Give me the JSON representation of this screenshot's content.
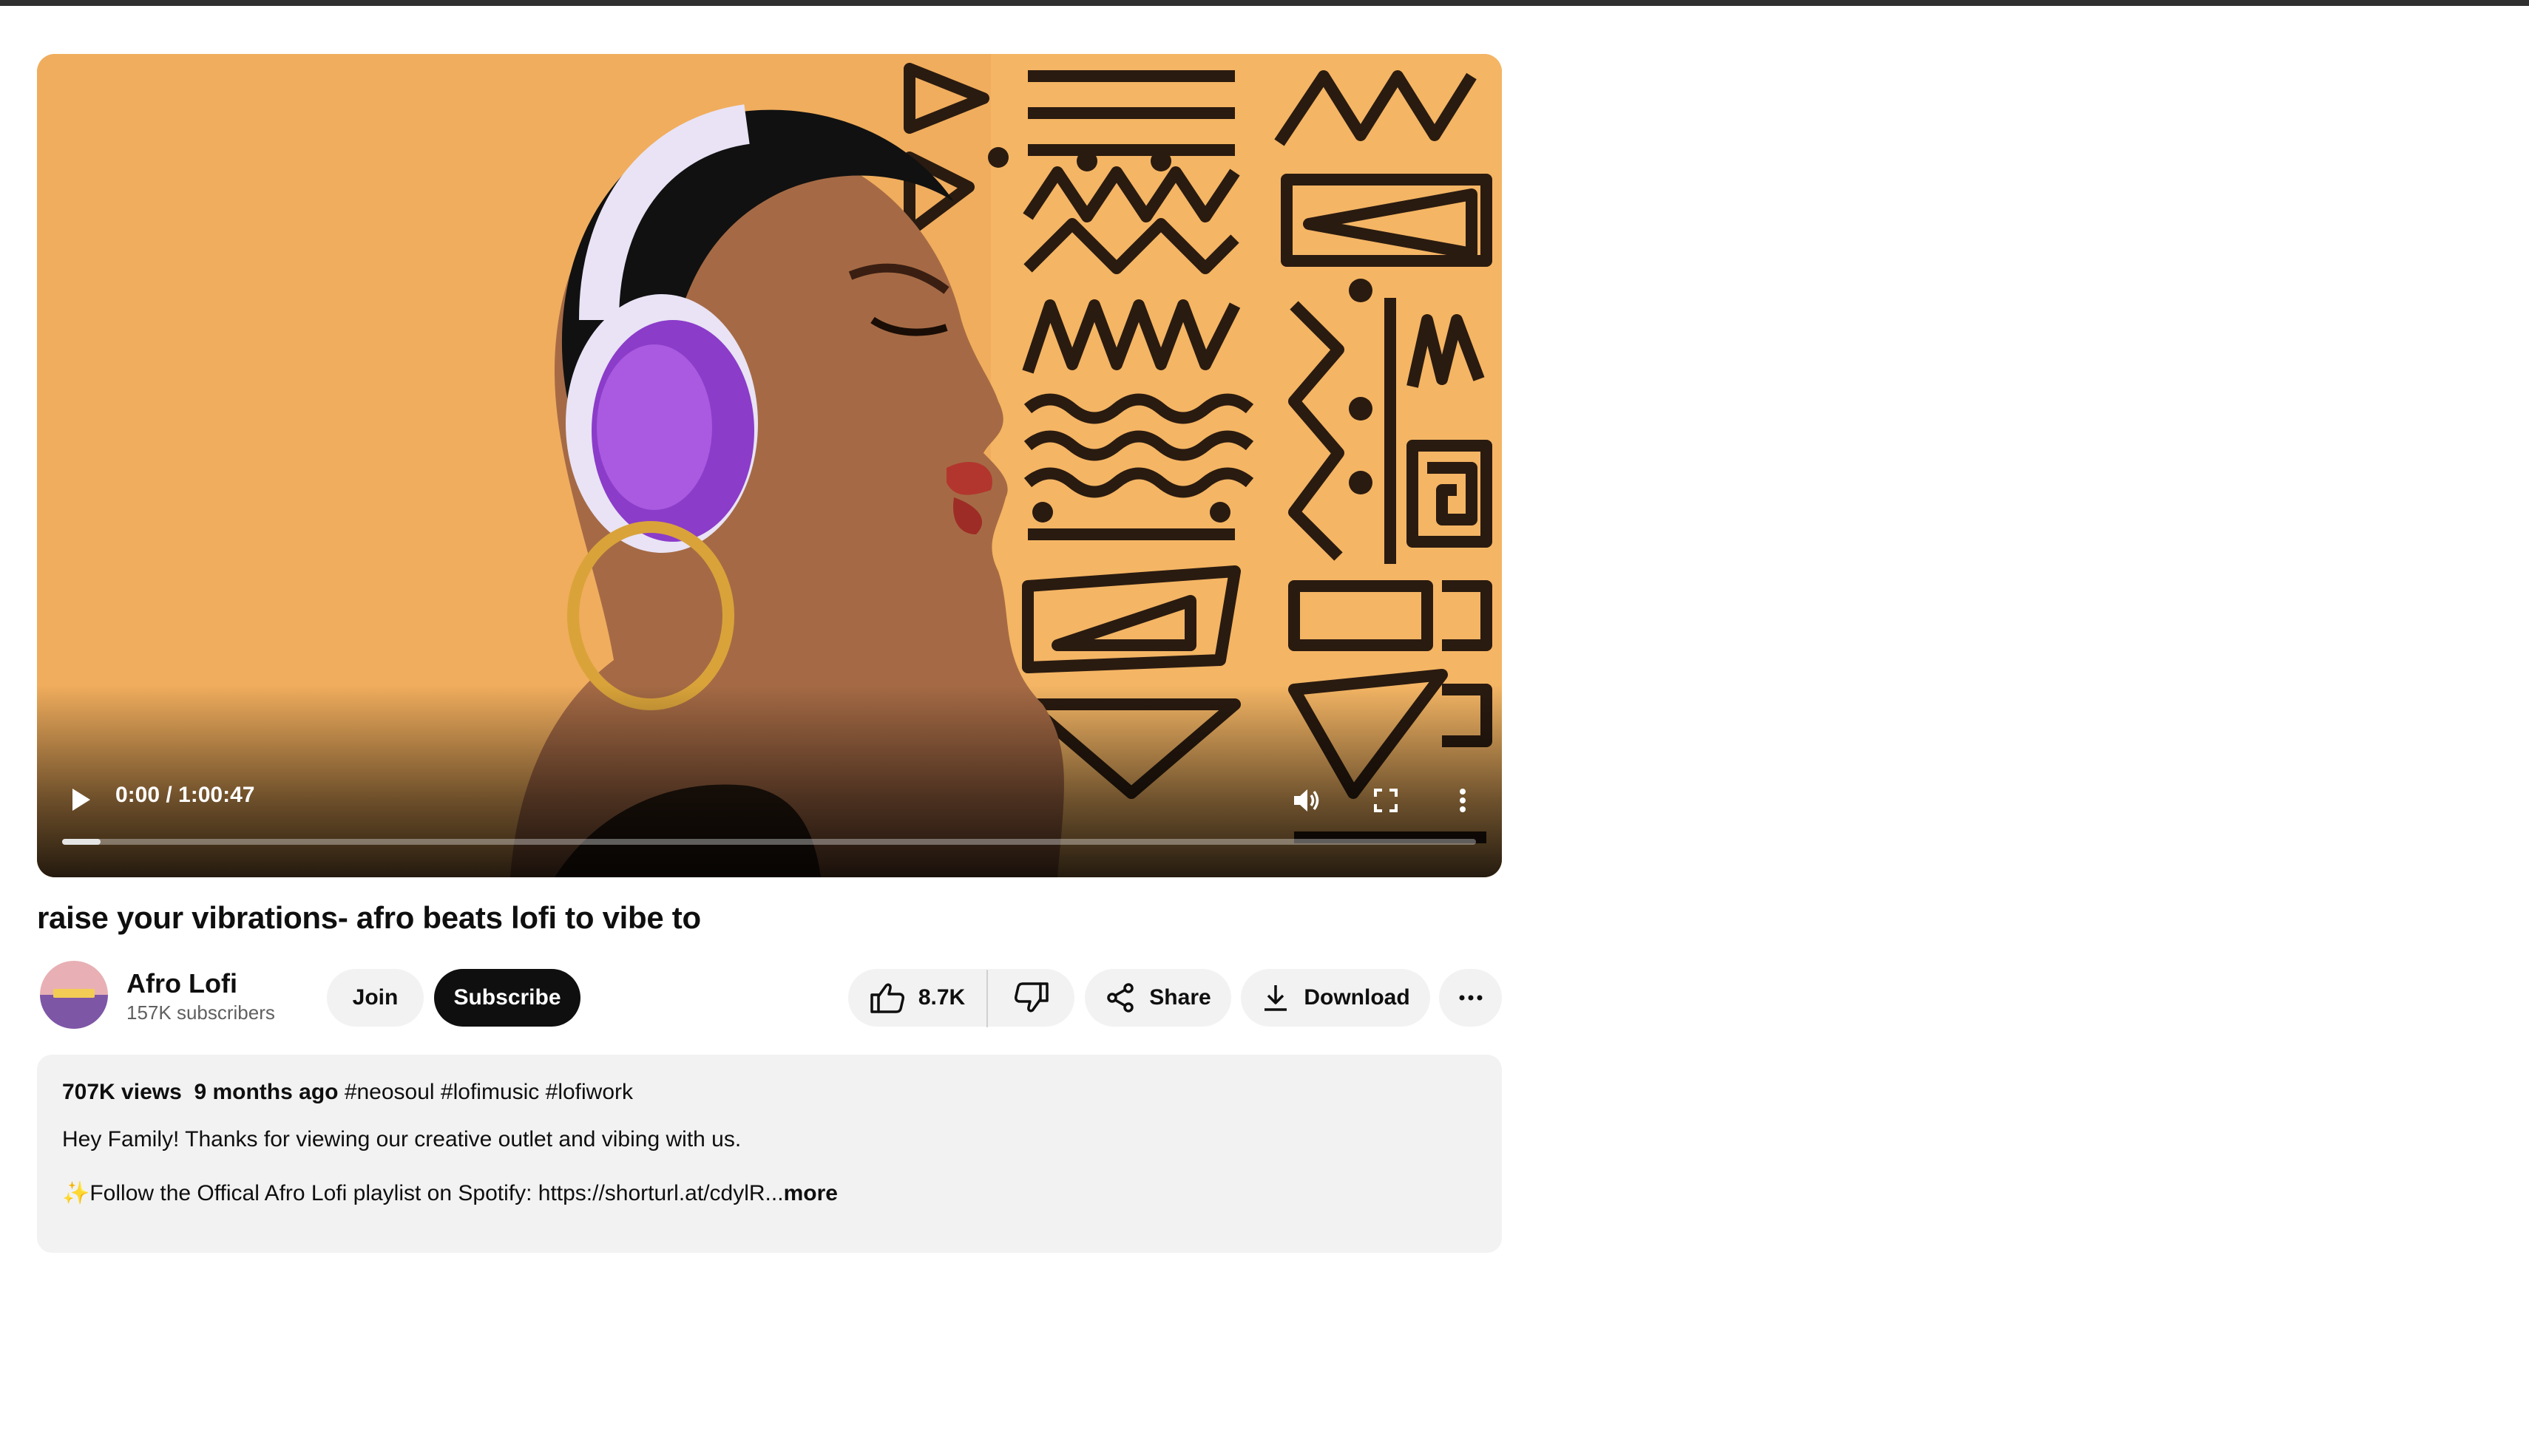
{
  "player": {
    "time_display": "0:00 / 1:00:47",
    "progress_fraction": 0.027,
    "icons": [
      "play-icon",
      "volume-icon",
      "fullscreen-icon",
      "more-vert-icon"
    ]
  },
  "video": {
    "title": "raise your vibrations- afro beats lofi to vibe to"
  },
  "channel": {
    "name": "Afro Lofi",
    "subscribers": "157K subscribers",
    "avatar_text": "Afro Lofi"
  },
  "actions": {
    "join_label": "Join",
    "subscribe_label": "Subscribe",
    "like_count": "8.7K",
    "share_label": "Share",
    "download_label": "Download"
  },
  "description": {
    "views": "707K views",
    "date": "9 months ago",
    "hashtags": "#neosoul #lofimusic #lofiwork",
    "line1": "Hey Family! Thanks for viewing our creative outlet and vibing with us.",
    "line2_emoji": "✨",
    "line2": "Follow the Offical Afro Lofi playlist on Spotify: https://shorturl.at/cdylR...",
    "more_label": "more"
  },
  "colors": {
    "thumbnail_background": "#f0ad5d",
    "subscribe_bg": "#0f0f0f",
    "pill_bg": "#f2f2f2",
    "description_bg": "#f2f2f2"
  }
}
